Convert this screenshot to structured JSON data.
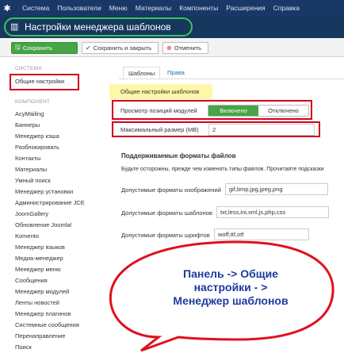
{
  "topbar": {
    "logo_icon": "joomla-icon",
    "items": [
      "Система",
      "Пользователи",
      "Меню",
      "Материалы",
      "Компоненты",
      "Расширения",
      "Справка"
    ]
  },
  "title": {
    "icon": "template-manager-icon",
    "text": "Настройки менеджера шаблонов"
  },
  "toolbar": {
    "save_label": "Сохранить",
    "save_close_label": "Сохранить и закрыть",
    "cancel_label": "Отменить"
  },
  "sidebar": {
    "system_header": "СИСТЕМА",
    "active_item": "Общие настройки",
    "component_header": "КОМПОНЕНТ",
    "items": [
      "AcyMailing",
      "Баннеры",
      "Менеджер кэша",
      "Разблокировать",
      "Контакты",
      "Материалы",
      "Умный поиск",
      "Менеджер установки",
      "Администрирование JCE",
      "JoomGallery",
      "Обновление Joomla!",
      "Komento",
      "Менеджер языков",
      "Медиа-менеджер",
      "Менеджер меню",
      "Сообщения",
      "Менеджер модулей",
      "Ленты новостей",
      "Менеджер плагинов",
      "Системные сообщения",
      "Перенаправление",
      "Поиск"
    ]
  },
  "tabs": {
    "templates": "Шаблоны",
    "rights": "Права"
  },
  "form": {
    "legend": "Общие настройки шаблонов",
    "preview_label": "Просмотр позиций модулей",
    "toggle_on": "Включено",
    "toggle_off": "Отключено",
    "max_size_label": "Максимальный размер (MB)",
    "max_size_value": "2",
    "formats_title": "Поддерживаемые форматы файлов",
    "formats_note": "Будьте осторожны, прежде чем изменять типы файлов. Прочитайте подсказки",
    "image_formats_label": "Допустимые форматы изображений",
    "image_formats_value": "gif,bmp,jpg,jpeg,png",
    "template_formats_label": "Допустимые форматы шаблонов",
    "template_formats_value": "txt,less,ini,xml,js,php,css",
    "font_formats_label": "Допустимые форматы шрифтов",
    "font_formats_value": "woff,ttf,otf"
  },
  "callout": {
    "text": "Панель -> Общие\nнастройки   - >\nМенеджер шаблонов"
  },
  "colors": {
    "topbar": "#1a3867",
    "titlebar": "#17375e",
    "accent_green": "#46a546",
    "highlight_red": "#d0021b",
    "callout_text": "#1d3a9e"
  }
}
